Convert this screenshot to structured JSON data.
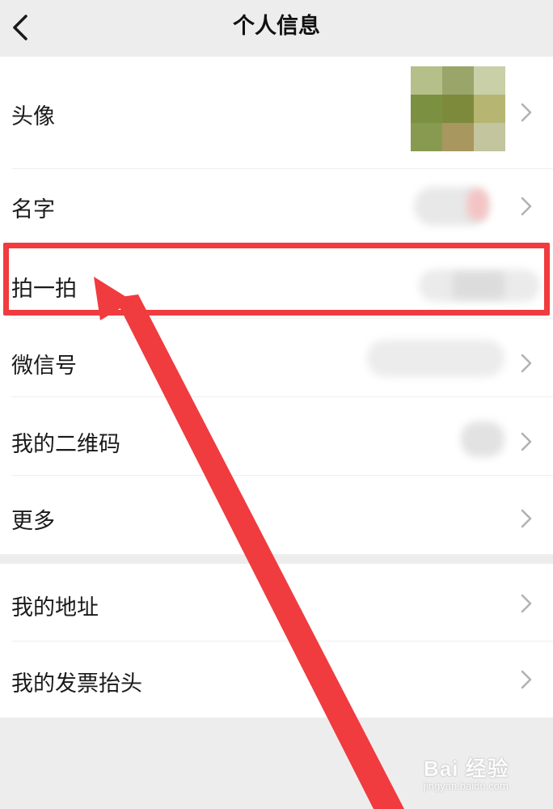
{
  "navbar": {
    "title": "个人信息",
    "back_icon": "chevron-left-icon"
  },
  "profile_rows": [
    {
      "label": "头像",
      "value": "",
      "icon": "chevron-right-icon"
    },
    {
      "label": "名字",
      "value": "",
      "icon": "chevron-right-icon"
    },
    {
      "label": "拍一拍",
      "value": ""
    },
    {
      "label": "微信号",
      "value": "",
      "icon": "chevron-right-icon"
    },
    {
      "label": "我的二维码",
      "value": "",
      "icon": "chevron-right-icon"
    },
    {
      "label": "更多",
      "value": "",
      "icon": "chevron-right-icon"
    }
  ],
  "extra_rows": [
    {
      "label": "我的地址",
      "icon": "chevron-right-icon"
    },
    {
      "label": "我的发票抬头",
      "icon": "chevron-right-icon"
    }
  ],
  "annotation": {
    "highlight_color": "#f03b3f",
    "arrow_color": "#f03b3f",
    "target": "拍一拍"
  },
  "watermark": {
    "text": "Bai 经验",
    "subtext": "jingyan.baidu.com"
  },
  "colors": {
    "background": "#ededed",
    "card": "#ffffff",
    "chevron": "#b2b2b2"
  }
}
